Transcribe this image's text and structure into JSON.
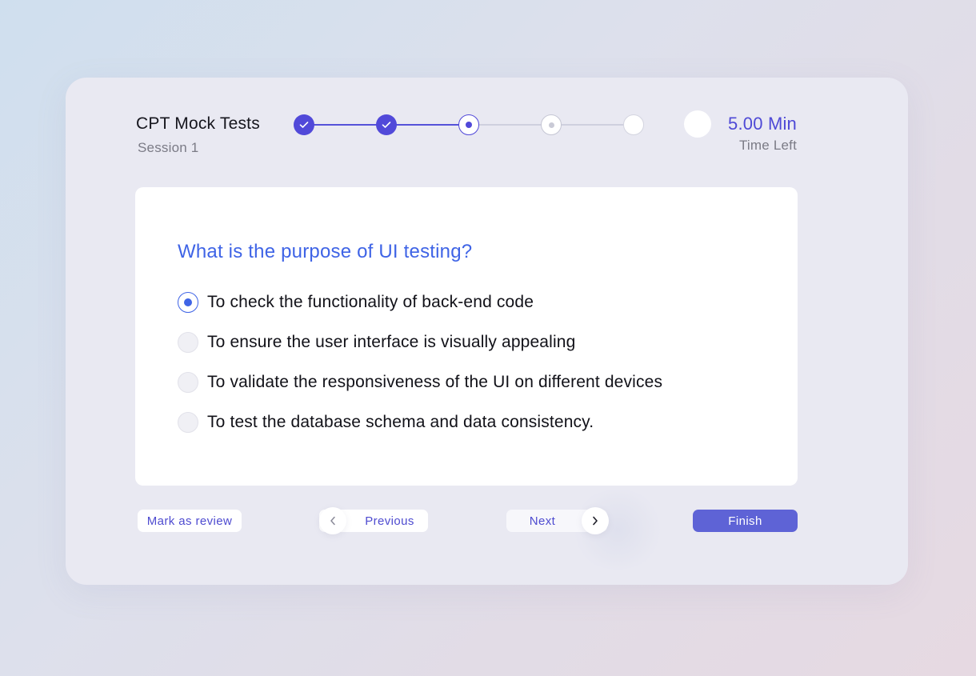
{
  "header": {
    "title": "CPT Mock Tests",
    "subtitle": "Session 1"
  },
  "stepper": {
    "steps": [
      {
        "state": "done",
        "icon": "check-icon"
      },
      {
        "state": "done",
        "icon": "check-icon"
      },
      {
        "state": "current",
        "icon": "dot-icon"
      },
      {
        "state": "pending",
        "icon": "dot-icon"
      },
      {
        "state": "empty",
        "icon": ""
      }
    ],
    "completed": 2,
    "total": 5,
    "accent": "#5149d9"
  },
  "timer": {
    "value": "5.00 Min",
    "label": "Time Left"
  },
  "question": {
    "text": "What is the purpose of UI testing?",
    "selected_index": 0,
    "options": [
      "To check the functionality of back-end code",
      "To ensure the user interface is visually appealing",
      "To validate the responsiveness of the UI on different devices",
      "To test the database schema and data consistency."
    ]
  },
  "actions": {
    "review_label": "Mark as review",
    "previous_label": "Previous",
    "next_label": "Next",
    "finish_label": "Finish"
  },
  "colors": {
    "accent": "#4e49d6",
    "question": "#3f64e6",
    "finish_button": "#5e63d6"
  }
}
